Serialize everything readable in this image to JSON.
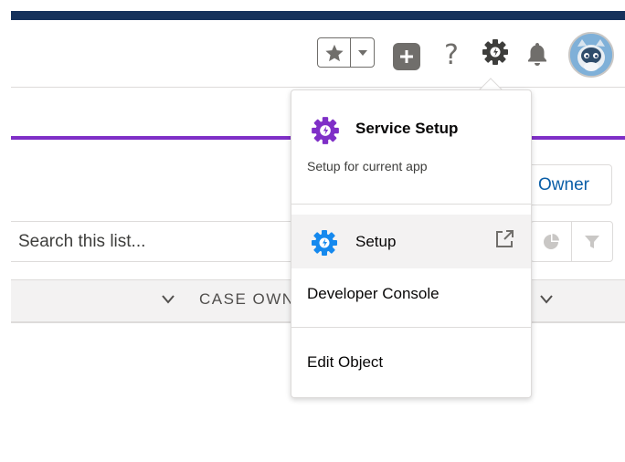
{
  "colors": {
    "topbar": "#16325c",
    "accent_purple": "#7f2fc7",
    "link_blue": "#0b5fa8",
    "icon_gray": "#706e6b",
    "setup_icon_blue": "#1589ee",
    "service_icon_purple": "#7f2fc7"
  },
  "header": {
    "favorites_icon": "star-icon",
    "favorites_dropdown_icon": "chevron-down-icon",
    "global_actions_icon": "plus-icon",
    "help_label": "?",
    "setup_icon": "gear-icon",
    "notifications_icon": "bell-icon",
    "avatar_icon": "astro-avatar"
  },
  "list": {
    "owner_button": "Owner",
    "search_placeholder": "Search this list...",
    "chart_icon": "pie-chart-icon",
    "filter_icon": "filter-icon",
    "column_header": "CASE OWN"
  },
  "setup_menu": {
    "service_setup": {
      "title": "Service Setup",
      "subtitle": "Setup for current app"
    },
    "items": [
      {
        "label": "Setup"
      },
      {
        "label": "Developer Console"
      },
      {
        "label": "Edit Object"
      }
    ]
  }
}
